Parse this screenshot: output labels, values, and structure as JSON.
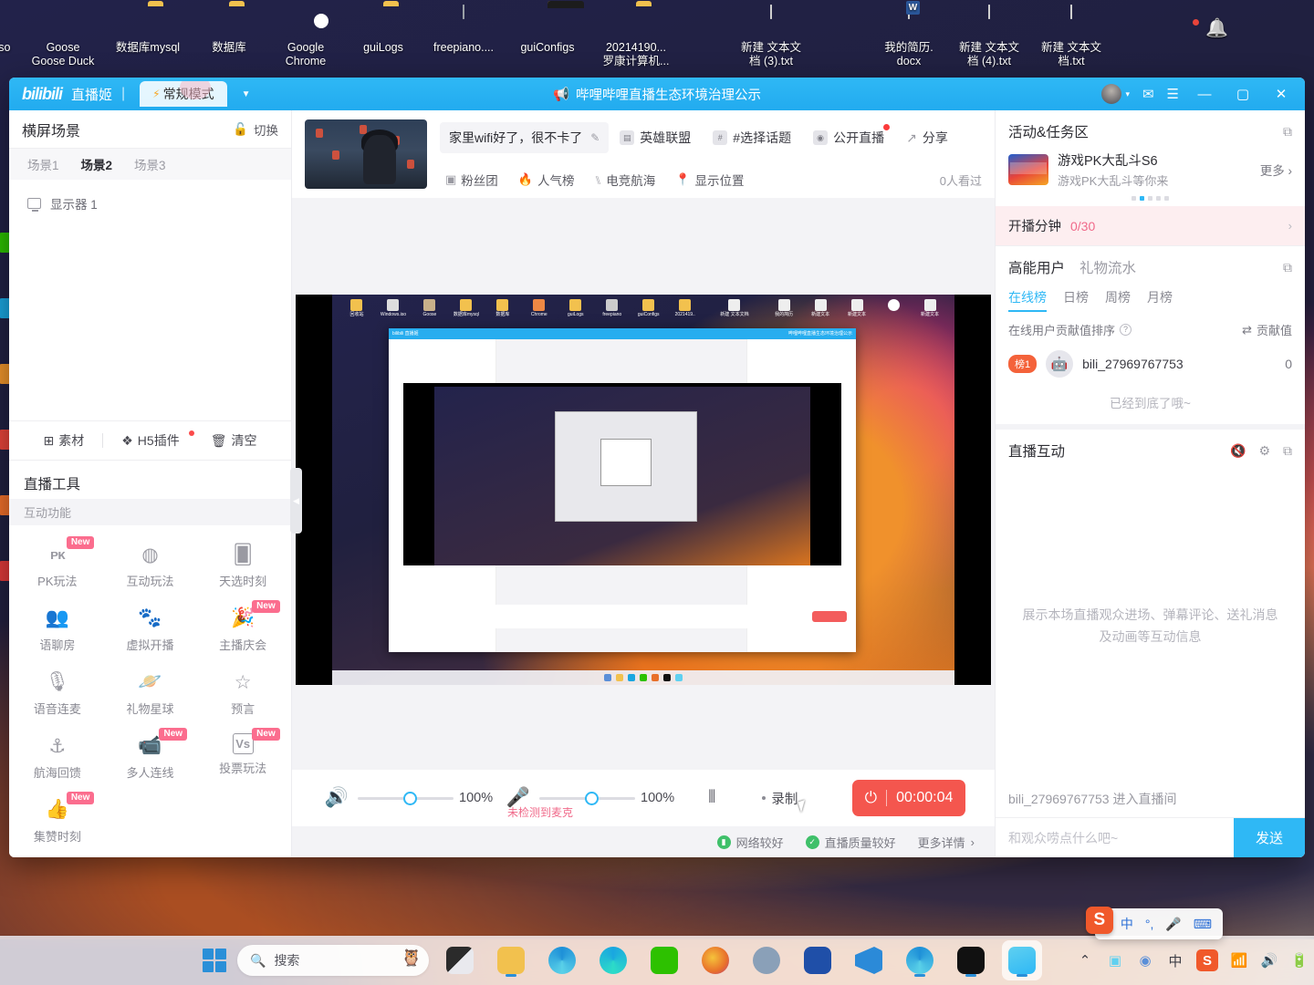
{
  "desktop": {
    "icons": [
      {
        "label": "vs.iso",
        "icon": "disc-image-icon",
        "type": "doc"
      },
      {
        "label": "Goose\nGoose Duck",
        "icon": "goose-goose-duck-icon",
        "type": "goose"
      },
      {
        "label": "数据库mysql",
        "icon": "folder-icon",
        "type": "folder"
      },
      {
        "label": "数据库",
        "icon": "folder-icon",
        "type": "folder"
      },
      {
        "label": "Google\nChrome",
        "icon": "chrome-icon",
        "type": "chrome"
      },
      {
        "label": "guiLogs",
        "icon": "folder-icon",
        "type": "folder"
      },
      {
        "label": "freepiano....",
        "icon": "freepiano-icon",
        "type": "piano"
      },
      {
        "label": "guiConfigs",
        "icon": "folder-icon",
        "type": "folder-dark"
      },
      {
        "label": "20214190...\n罗康计算机...",
        "icon": "folder-icon",
        "type": "folder"
      },
      {
        "label": "新建 文本文\n档 (3).txt",
        "icon": "text-file-icon",
        "type": "doc"
      },
      {
        "label": "我的简历.\ndocx",
        "icon": "word-document-icon",
        "type": "word"
      },
      {
        "label": "新建 文本文\n档 (4).txt",
        "icon": "text-file-icon",
        "type": "doc"
      },
      {
        "label": "新建 文本文\n档.txt",
        "icon": "text-file-icon",
        "type": "doc"
      },
      {
        "label": "",
        "icon": "notification-bell-icon",
        "type": "bell"
      }
    ]
  },
  "app": {
    "titlebar": {
      "logo": "bilibili",
      "app_name": "直播姬",
      "mode": "常规模式",
      "announcement": "哔哩哔哩直播生态环境治理公示",
      "minimize": "—",
      "maximize": "▢",
      "close": "✕"
    },
    "left_panel": {
      "header_title": "横屏场景",
      "switch_label": "切换",
      "scenes": [
        {
          "label": "场景1",
          "active": false
        },
        {
          "label": "场景2",
          "active": true
        },
        {
          "label": "场景3",
          "active": false
        }
      ],
      "layers": [
        {
          "label": "显示器 1",
          "icon": "monitor-icon"
        }
      ],
      "actions": [
        {
          "label": "素材",
          "icon": "add-material-icon",
          "badge": false
        },
        {
          "label": "H5插件",
          "icon": "h5-plugin-icon",
          "badge": true
        },
        {
          "label": "清空",
          "icon": "trash-icon",
          "badge": false
        }
      ],
      "tools_title": "直播工具",
      "tools_subtitle": "互动功能",
      "tools": [
        {
          "label": "PK玩法",
          "icon": "pk-icon",
          "glyph": "PK",
          "new": true
        },
        {
          "label": "互动玩法",
          "icon": "interactive-play-icon",
          "glyph": "✇",
          "new": false
        },
        {
          "label": "天选时刻",
          "icon": "lucky-draw-icon",
          "glyph": "▯",
          "new": false
        },
        {
          "label": "语聊房",
          "icon": "voice-room-icon",
          "glyph": "☍",
          "new": false
        },
        {
          "label": "虚拟开播",
          "icon": "virtual-avatar-icon",
          "glyph": "☺",
          "new": false
        },
        {
          "label": "主播庆会",
          "icon": "streamer-party-icon",
          "glyph": "✧",
          "new": true
        },
        {
          "label": "语音连麦",
          "icon": "voice-mic-link-icon",
          "glyph": "⚲",
          "new": false
        },
        {
          "label": "礼物星球",
          "icon": "gift-planet-icon",
          "glyph": "◯",
          "new": false
        },
        {
          "label": "预言",
          "icon": "prediction-icon",
          "glyph": "☆",
          "new": false
        },
        {
          "label": "航海回馈",
          "icon": "voyage-reward-icon",
          "glyph": "⚓",
          "new": false
        },
        {
          "label": "多人连线",
          "icon": "multi-connect-icon",
          "glyph": "❏",
          "new": true
        },
        {
          "label": "投票玩法",
          "icon": "vote-icon",
          "glyph": "Vs",
          "new": true
        },
        {
          "label": "集赞时刻",
          "icon": "like-collect-icon",
          "glyph": "👍",
          "new": true
        }
      ]
    },
    "stream_header": {
      "cover_alt": "stream-cover-thumbnail",
      "title": "家里wifi好了，很不卡了",
      "edit_icon": "edit-icon",
      "category": "英雄联盟",
      "topic": "#选择话题",
      "privacy": "公开直播",
      "share": "分享",
      "chips": [
        {
          "label": "粉丝团",
          "icon": "fan-club-icon"
        },
        {
          "label": "人气榜",
          "icon": "popularity-rank-icon"
        },
        {
          "label": "电竞航海",
          "icon": "esports-voyage-icon"
        },
        {
          "label": "显示位置",
          "icon": "location-pin-icon"
        }
      ],
      "viewers": "0人看过"
    },
    "controls": {
      "speaker_icon": "speaker-icon",
      "speaker_value": "100%",
      "mic_icon": "microphone-icon",
      "mic_value": "100%",
      "mic_warning": "未检测到麦克",
      "mixer_icon": "audio-mixer-icon",
      "record_label": "录制",
      "live_timer": "00:00:04",
      "power_icon": "power-icon",
      "status": [
        {
          "label": "网络较好",
          "icon": "signal-icon",
          "color": "#3fc06a"
        },
        {
          "label": "直播质量较好",
          "icon": "shield-icon",
          "color": "#3fc06a"
        }
      ],
      "more_details": "更多详情"
    },
    "right_panel": {
      "activity_title": "活动&任务区",
      "activity_popout_icon": "popout-icon",
      "activity": {
        "name": "游戏PK大乱斗S6",
        "desc": "游戏PK大乱斗等你来",
        "more": "更多"
      },
      "carousel_dots": 5,
      "carousel_active": 1,
      "task": {
        "name": "开播分钟",
        "value": "0/30",
        "arrow": "›"
      },
      "users_title": "高能用户",
      "gift_title": "礼物流水",
      "rank_tabs": [
        {
          "label": "在线榜",
          "active": true
        },
        {
          "label": "日榜",
          "active": false
        },
        {
          "label": "周榜",
          "active": false
        },
        {
          "label": "月榜",
          "active": false
        }
      ],
      "rank_sub": "在线用户贡献值排序",
      "rank_sort": "贡献值",
      "rank_items": [
        {
          "rank": "榜1",
          "name": "bili_27969767753",
          "value": "0",
          "avatar": "robot-avatar-icon"
        }
      ],
      "rank_end": "已经到底了哦~",
      "chat_title": "直播互动",
      "chat_icons": [
        "mute-icon",
        "settings-gear-icon",
        "popout-icon"
      ],
      "chat_empty": "展示本场直播观众进场、弹幕评论、送礼消息及动画等互动信息",
      "chat_message": "bili_27969767753 进入直播间",
      "chat_placeholder": "和观众唠点什么吧~",
      "send_label": "发送"
    },
    "preview": {
      "alt": "screen-capture-preview-recursive"
    }
  },
  "taskbar": {
    "start_icon": "windows-start-icon",
    "search_placeholder": "搜索",
    "search_icon": "search-icon",
    "apps": [
      {
        "name": "task-view-icon",
        "color": "#2b2b2b"
      },
      {
        "name": "file-explorer-icon",
        "color": "#f2c14e"
      },
      {
        "name": "edge-dev-icon",
        "color": "#1e90d8"
      },
      {
        "name": "edge-icon",
        "color": "#1aa6e0"
      },
      {
        "name": "wechat-icon",
        "color": "#2dc100"
      },
      {
        "name": "firefox-icon",
        "color": "#e8702a"
      },
      {
        "name": "settings-icon",
        "color": "#8aa0b8"
      },
      {
        "name": "lol-client-icon",
        "color": "#1f4fa8"
      },
      {
        "name": "vscode-icon",
        "color": "#2b8ad8"
      },
      {
        "name": "edge-dev2-icon",
        "color": "#1e90d8"
      },
      {
        "name": "tiktok-icon",
        "color": "#111111"
      },
      {
        "name": "bilibili-live-icon",
        "color": "#5fd0f0"
      }
    ],
    "tray": {
      "chevron_icon": "show-hidden-icons-icon",
      "ime_lang": "中",
      "sogou_icon": "sogou-ime-icon",
      "wifi_icon": "wifi-icon",
      "volume_icon": "volume-icon",
      "battery_icon": "battery-icon"
    },
    "ime_bar": {
      "logo": "S",
      "lang": "中",
      "punct": "°,",
      "mic_icon": "mic-icon",
      "keyboard_icon": "keyboard-icon"
    }
  }
}
